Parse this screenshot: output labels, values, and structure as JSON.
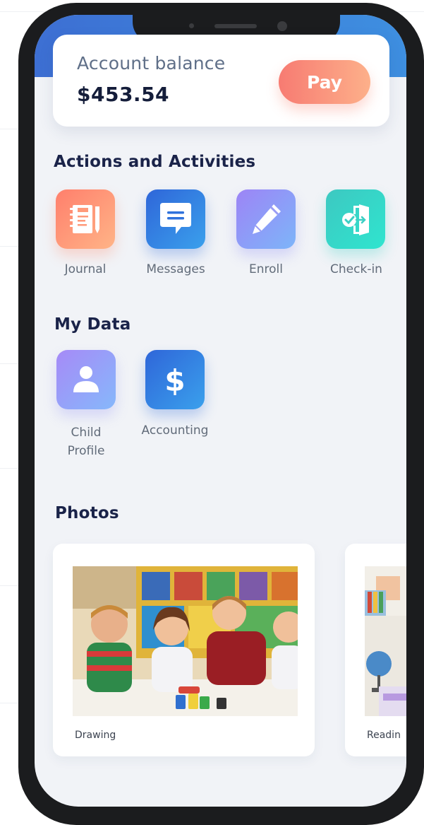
{
  "balance": {
    "label": "Account balance",
    "value": "$453.54",
    "pay_label": "Pay"
  },
  "sections": {
    "actions_title": "Actions and Activities",
    "my_data_title": "My Data",
    "photos_title": "Photos"
  },
  "actions": [
    {
      "label": "Journal",
      "icon": "journal-icon"
    },
    {
      "label": "Messages",
      "icon": "message-icon"
    },
    {
      "label": "Enroll",
      "icon": "pencil-icon"
    },
    {
      "label": "Check-in",
      "icon": "door-check-icon"
    }
  ],
  "my_data": [
    {
      "label_line1": "Child",
      "label_line2": "Profile",
      "icon": "person-icon"
    },
    {
      "label": "Accounting",
      "icon": "dollar-icon"
    }
  ],
  "photos": [
    {
      "caption": "Drawing"
    },
    {
      "caption": "Readin"
    }
  ],
  "colors": {
    "header_blue": "#3d6fd3",
    "pay_gradient_start": "#f77b72",
    "pay_gradient_end": "#fdb08a",
    "heading_text": "#1a2349",
    "screen_bg": "#f1f3f7"
  }
}
